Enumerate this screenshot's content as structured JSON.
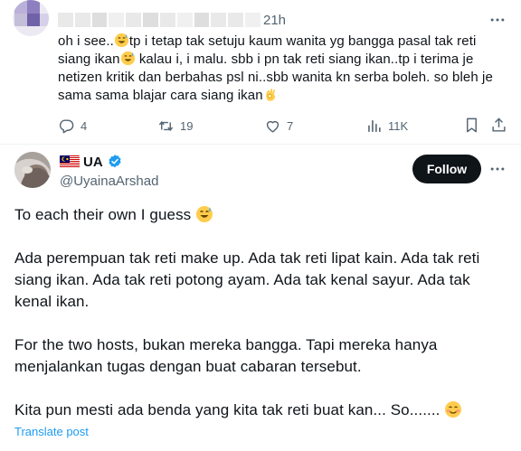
{
  "reply": {
    "time": "21h",
    "text_line1_a": "oh i see..",
    "text_line1_b": "tp i tetap tak setuju kaum wanita yg bangga pasal tak reti",
    "text_line2_a": "siang ikan",
    "text_line2_b": "kalau i, i malu. sbb i pn tak reti siang ikan..tp i terima je",
    "text_line3": "netizen kritik dan berbahas psl ni..sbb wanita kn serba boleh. so bleh je",
    "text_line4": "sama sama blajar cara siang ikan",
    "stats": {
      "replies": "4",
      "reposts": "19",
      "likes": "7",
      "views": "11K"
    }
  },
  "main": {
    "display_name": "UA",
    "handle": "@UyainaArshad",
    "follow_label": "Follow",
    "p1": "To each their own I guess",
    "p2": "Ada perempuan tak reti make up. Ada tak reti lipat kain. Ada tak reti siang ikan. Ada tak reti potong ayam. Ada tak kenal sayur. Ada tak kenal ikan.",
    "p3": "For the two hosts, bukan mereka bangga. Tapi mereka hanya menjalankan tugas dengan buat cabaran tersebut.",
    "p4": "Kita pun mesti ada benda yang kita tak reti buat kan... So.......",
    "translate_label": "Translate post"
  },
  "colors": {
    "text": "#0f1419",
    "muted": "#536471",
    "accent": "#1d9bf0",
    "follow_bg": "#0f1419"
  },
  "icons": [
    "more-icon",
    "reply-icon",
    "repost-icon",
    "like-icon",
    "views-icon",
    "bookmark-icon",
    "share-icon",
    "verified-badge-icon",
    "malaysia-flag-icon",
    "sweat-smile-emoji",
    "ok-hand-emoji",
    "smile-emoji"
  ]
}
